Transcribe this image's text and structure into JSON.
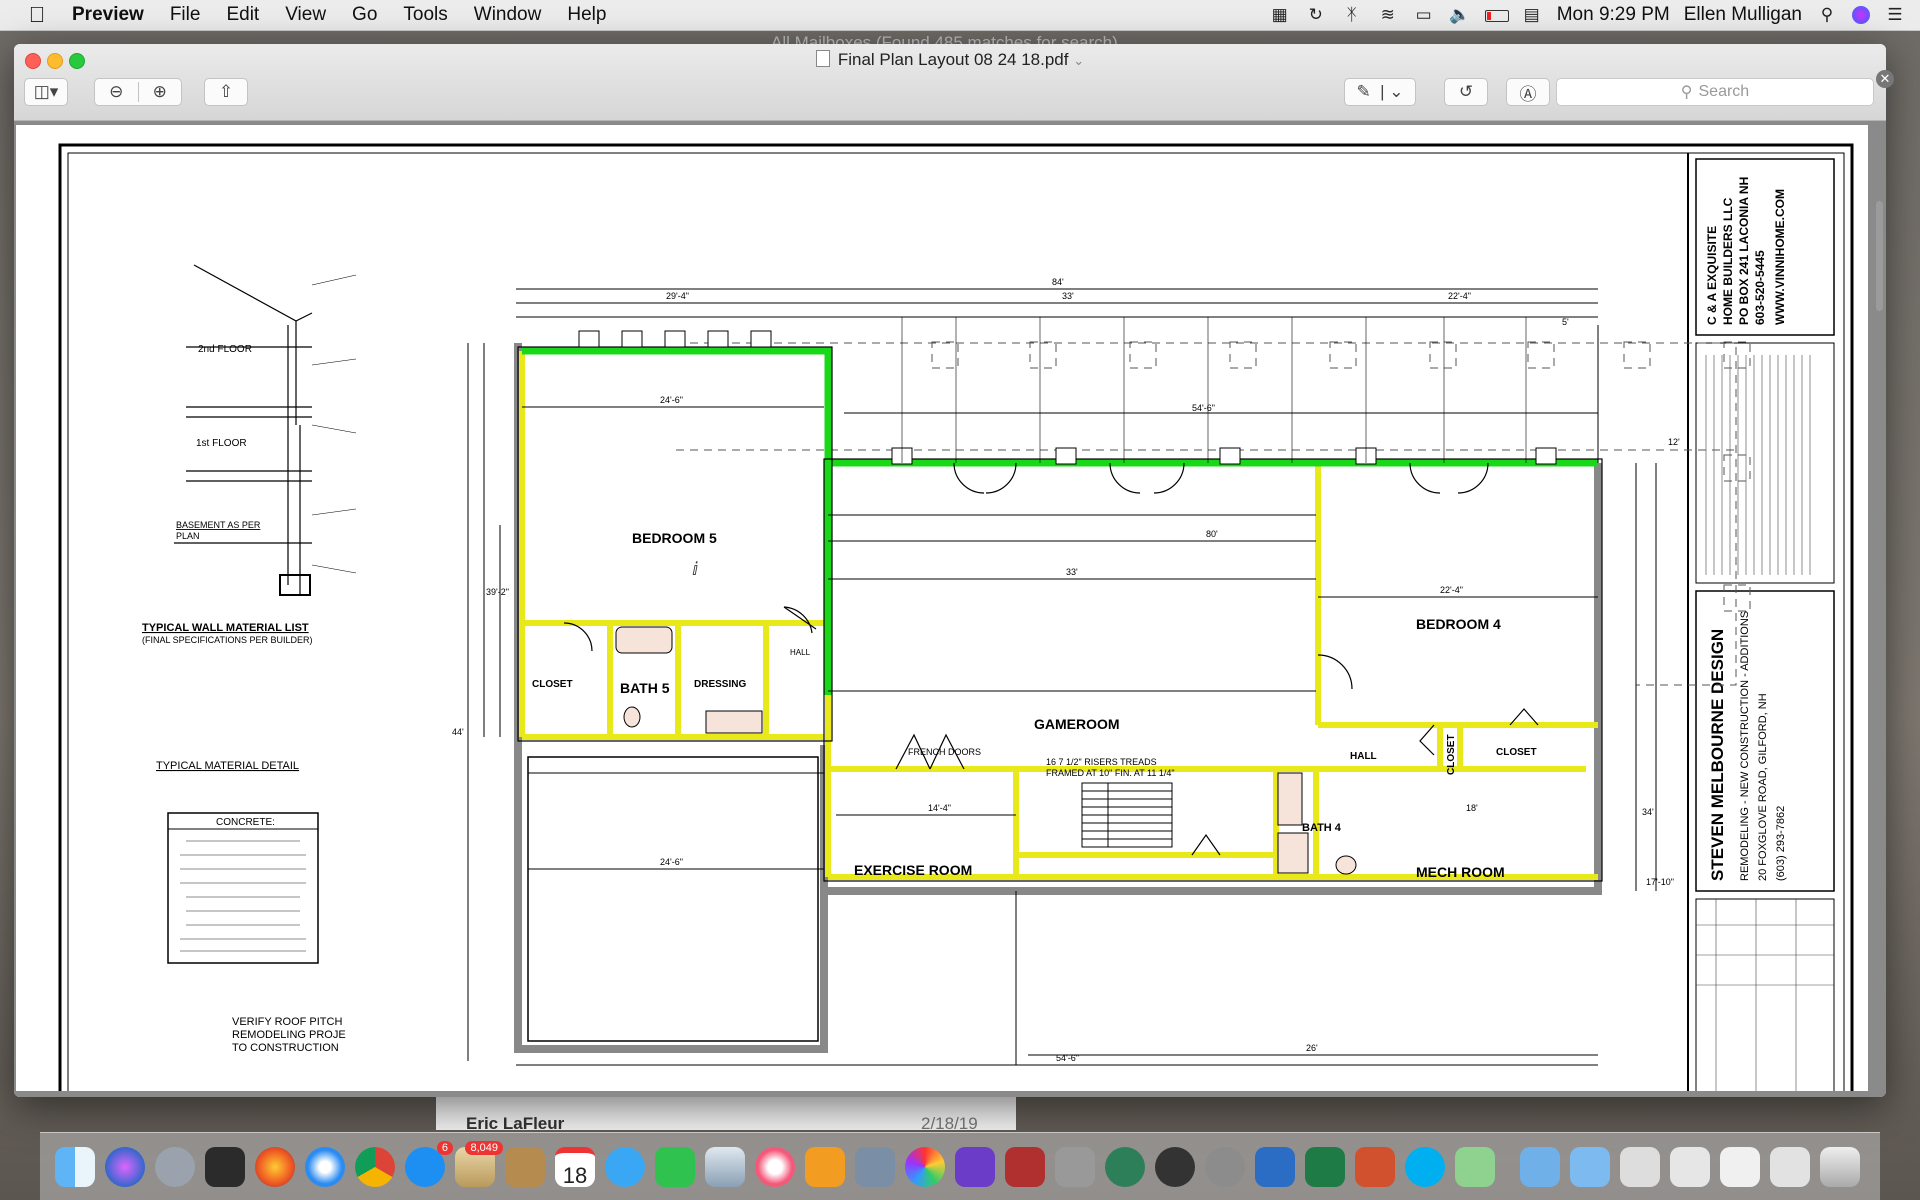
{
  "menubar": {
    "app": "Preview",
    "items": [
      "File",
      "Edit",
      "View",
      "Go",
      "Tools",
      "Window",
      "Help"
    ],
    "clock": "Mon 9:29 PM",
    "user": "Ellen Mulligan",
    "status_icons": [
      "dropbox-icon",
      "time-machine-icon",
      "bluetooth-icon",
      "wifi-icon",
      "airplay-icon",
      "volume-icon",
      "battery-icon",
      "calendar-icon"
    ]
  },
  "behind": {
    "window_title": "All Mailboxes (Found 485 matches for search)",
    "mail_from": "Eric LaFleur",
    "mail_date": "2/18/19"
  },
  "window": {
    "title": "Final Plan Layout 08 24 18.pdf",
    "search_placeholder": "Search",
    "toolbar": [
      "sidebar-toggle-icon",
      "zoom-out-icon",
      "zoom-in-icon",
      "share-icon",
      "markup-pen-icon",
      "rotate-icon",
      "annotate-icon"
    ]
  },
  "plan": {
    "rooms": {
      "bedroom5": "BEDROOM 5",
      "bedroom4": "BEDROOM 4",
      "gameroom": "GAMEROOM",
      "exercise": "EXERCISE ROOM",
      "mech": "MECH ROOM",
      "bath5": "BATH 5",
      "bath4": "BATH 4",
      "closet_a": "CLOSET",
      "closet_b": "CLOSET",
      "closet_c": "CLOSET",
      "dressing": "DRESSING",
      "hall": "HALL",
      "hall_small": "HALL",
      "french_doors": "FRENCH DOORS",
      "stair_note1": "16  7 1/2\" RISERS  TREADS",
      "stair_note2": "FRAMED AT 10\" FIN. AT 11 1/4\""
    },
    "dims": {
      "top_overall": "84'",
      "top_left": "29'-4\"",
      "top_mid": "33'",
      "top_right": "22'-4\"",
      "d_246": "24'-6\"",
      "d_546": "54'-6\"",
      "d_33": "33'",
      "d_80": "80'",
      "d_224": "22'-4\"",
      "d_144": "14'-4\"",
      "d_18": "18'",
      "d_26": "26'",
      "bot": "54'-6\"",
      "d_12": "12'",
      "d_5": "5'",
      "d_34": "34'",
      "d_39": "39'-2\"",
      "d_44": "44'",
      "d_1710": "17'-10\""
    },
    "sidebar": {
      "company1": "C & A EXQUISITE",
      "company2": "HOME BUILDERS LLC",
      "company3": "PO BOX 241  LACONIA NH",
      "company4": "603-520-5445",
      "company5": "WWW.VINNIHOME.COM",
      "designer": "STEVEN MELBOURNE DESIGN",
      "designer2": "REMODELING - NEW CONSTRUCTION - ADDITIONS",
      "designer3": "20 FOXGLOVE ROAD, GILFORD, NH",
      "designer4": "(603) 293-7862"
    },
    "left": {
      "wall_title": "TYPICAL WALL MATERIAL LIST",
      "wall_sub": "(FINAL SPECIFICATIONS PER BUILDER)",
      "detail_title": "TYPICAL MATERIAL DETAIL",
      "second_floor": "2nd FLOOR",
      "first_floor": "1st FLOOR",
      "basement": "BASEMENT AS PER",
      "basement2": "PLAN",
      "concrete_title": "CONCRETE:",
      "verify1": "VERIFY ROOF PITCH",
      "verify2": "REMODELING PROJE",
      "verify3": "TO CONSTRUCTION"
    }
  },
  "dock": {
    "mail_badge": "8,049",
    "appstore_badge": "6",
    "calendar_day": "18"
  }
}
